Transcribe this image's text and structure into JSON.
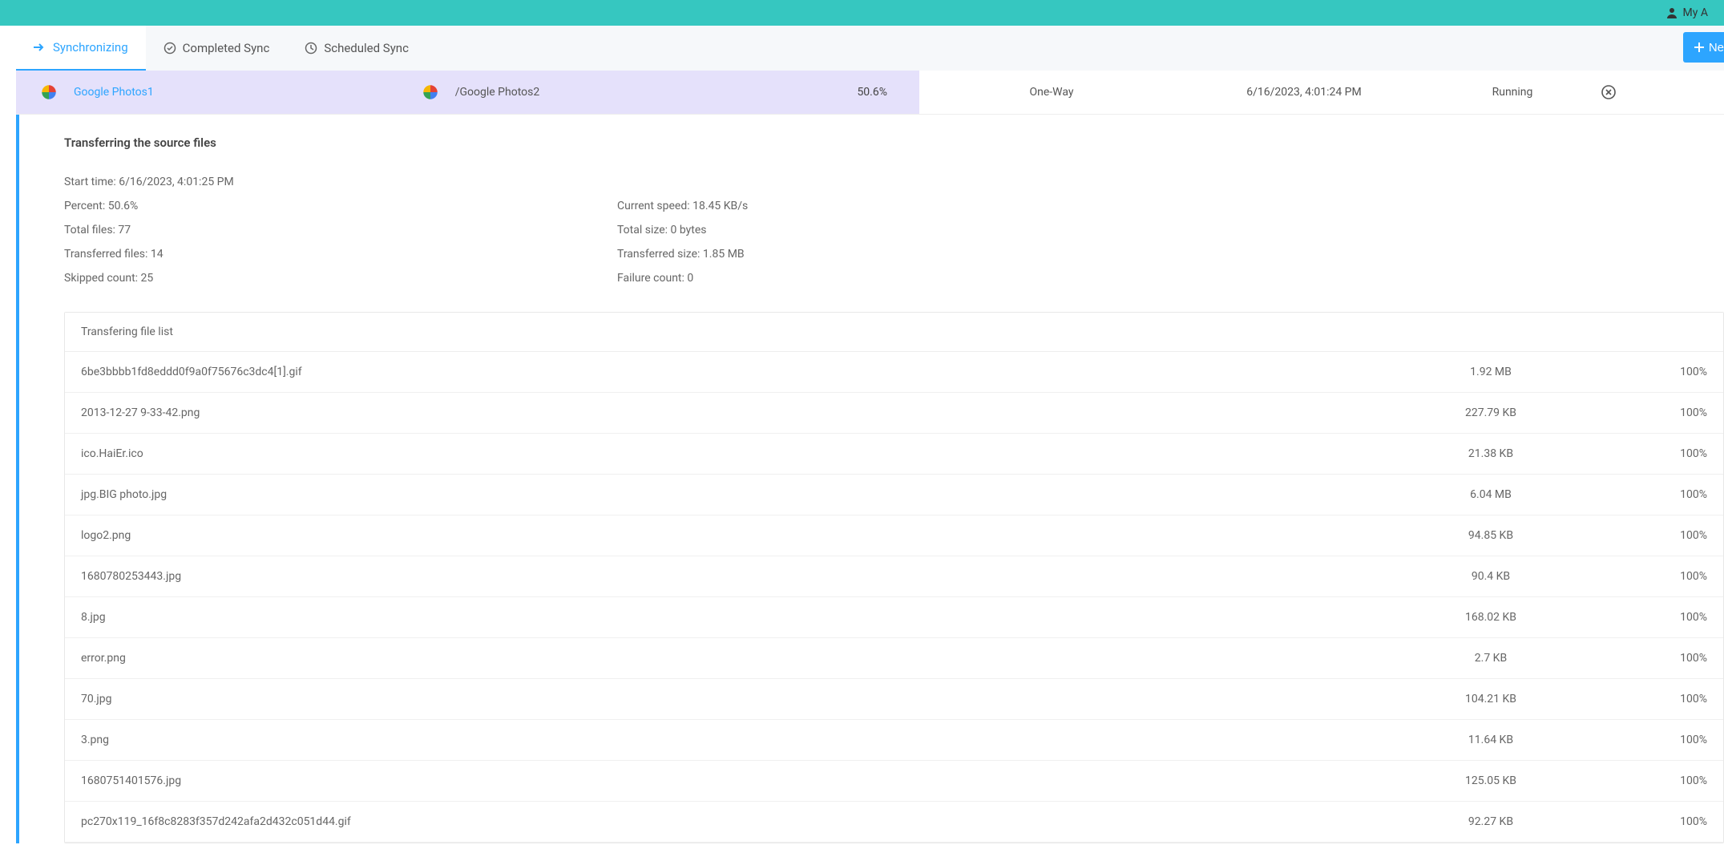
{
  "topbar": {
    "account_label": "My A"
  },
  "tabs": {
    "sync": "Synchronizing",
    "completed": "Completed Sync",
    "scheduled": "Scheduled Sync"
  },
  "new_task_label": "Ne",
  "task": {
    "source_label": "Google Photos1",
    "dest_label": "/Google Photos2",
    "percent": "50.6%",
    "mode": "One-Way",
    "timestamp": "6/16/2023, 4:01:24 PM",
    "status": "Running"
  },
  "details": {
    "title": "Transferring the source files",
    "start_time_label": "Start time: ",
    "start_time_value": "6/16/2023, 4:01:25 PM",
    "percent_label": "Percent: ",
    "percent_value": "50.6%",
    "total_files_label": "Total files: ",
    "total_files_value": "77",
    "transferred_files_label": "Transferred files: ",
    "transferred_files_value": "14",
    "skipped_count_label": "Skipped count: ",
    "skipped_count_value": "25",
    "current_speed_label": "Current speed: ",
    "current_speed_value": "18.45 KB/s",
    "total_size_label": "Total size: ",
    "total_size_value": "0 bytes",
    "transferred_size_label": "Transferred size: ",
    "transferred_size_value": "1.85 MB",
    "failure_count_label": "Failure count: ",
    "failure_count_value": "0"
  },
  "file_list_header": "Transfering file list",
  "files": [
    {
      "name": "6be3bbbb1fd8eddd0f9a0f75676c3dc4[1].gif",
      "size": "1.92 MB",
      "pct": "100%"
    },
    {
      "name": "2013-12-27 9-33-42.png",
      "size": "227.79 KB",
      "pct": "100%"
    },
    {
      "name": "ico.HaiEr.ico",
      "size": "21.38 KB",
      "pct": "100%"
    },
    {
      "name": "jpg.BIG photo.jpg",
      "size": "6.04 MB",
      "pct": "100%"
    },
    {
      "name": "logo2.png",
      "size": "94.85 KB",
      "pct": "100%"
    },
    {
      "name": "1680780253443.jpg",
      "size": "90.4 KB",
      "pct": "100%"
    },
    {
      "name": "8.jpg",
      "size": "168.02 KB",
      "pct": "100%"
    },
    {
      "name": "error.png",
      "size": "2.7 KB",
      "pct": "100%"
    },
    {
      "name": "70.jpg",
      "size": "104.21 KB",
      "pct": "100%"
    },
    {
      "name": "3.png",
      "size": "11.64 KB",
      "pct": "100%"
    },
    {
      "name": "1680751401576.jpg",
      "size": "125.05 KB",
      "pct": "100%"
    },
    {
      "name": "pc270x119_16f8c8283f357d242afa2d432c051d44.gif",
      "size": "92.27 KB",
      "pct": "100%"
    }
  ]
}
